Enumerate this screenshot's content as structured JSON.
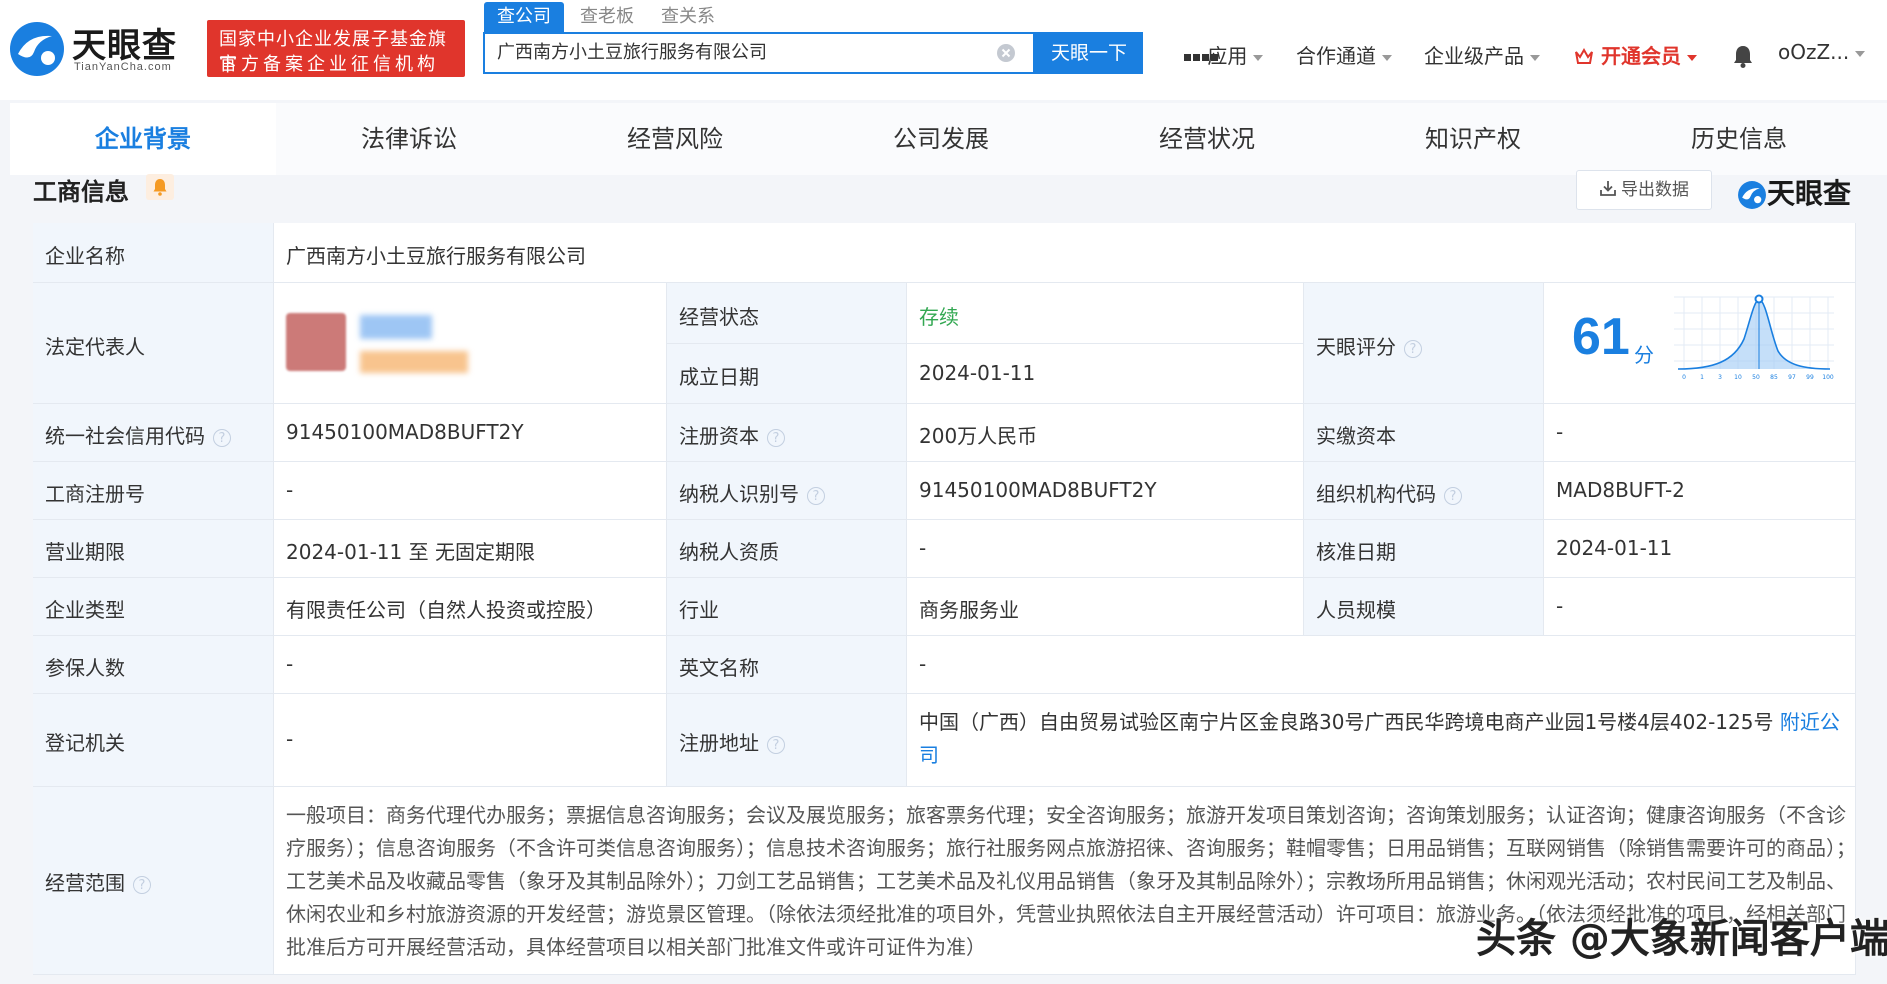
{
  "header": {
    "logo_text": "天眼查",
    "logo_sub": "TianYanCha.com",
    "gov_badge_line1": "国家中小企业发展子基金旗下",
    "gov_badge_line2": "官方备案企业征信机构",
    "search_tabs": [
      "查公司",
      "查老板",
      "查关系"
    ],
    "search_value": "广西南方小土豆旅行服务有限公司",
    "search_button": "天眼一下",
    "nav": {
      "apps": "应用",
      "partner": "合作通道",
      "enterprise": "企业级产品",
      "vip": "开通会员",
      "user": "oOzZ..."
    }
  },
  "tabs": [
    "企业背景",
    "法律诉讼",
    "经营风险",
    "公司发展",
    "经营状况",
    "知识产权",
    "历史信息"
  ],
  "section": {
    "title": "工商信息",
    "export": "导出数据",
    "brand": "天眼查"
  },
  "info": {
    "company_name_label": "企业名称",
    "company_name": "广西南方小土豆旅行服务有限公司",
    "legal_rep_label": "法定代表人",
    "status_label": "经营状态",
    "status": "存续",
    "founded_label": "成立日期",
    "founded": "2024-01-11",
    "score_label": "天眼评分",
    "score": "61",
    "score_unit": "分",
    "credit_code_label": "统一社会信用代码",
    "credit_code": "91450100MAD8BUFT2Y",
    "reg_capital_label": "注册资本",
    "reg_capital": "200万人民币",
    "paid_capital_label": "实缴资本",
    "paid_capital": "-",
    "reg_no_label": "工商注册号",
    "reg_no": "-",
    "taxpayer_id_label": "纳税人识别号",
    "taxpayer_id": "91450100MAD8BUFT2Y",
    "org_code_label": "组织机构代码",
    "org_code": "MAD8BUFT-2",
    "term_label": "营业期限",
    "term": "2024-01-11 至 无固定期限",
    "taxpayer_qual_label": "纳税人资质",
    "taxpayer_qual": "-",
    "approve_date_label": "核准日期",
    "approve_date": "2024-01-11",
    "type_label": "企业类型",
    "type": "有限责任公司（自然人投资或控股）",
    "industry_label": "行业",
    "industry": "商务服务业",
    "staff_label": "人员规模",
    "staff": "-",
    "insured_label": "参保人数",
    "insured": "-",
    "english_label": "英文名称",
    "english": "-",
    "authority_label": "登记机关",
    "authority": "-",
    "address_label": "注册地址",
    "address": "中国（广西）自由贸易试验区南宁片区金良路30号广西民华跨境电商产业园1号楼4层402-125号",
    "nearby": "附近公司",
    "scope_label": "经营范围",
    "scope": "一般项目：商务代理代办服务；票据信息咨询服务；会议及展览服务；旅客票务代理；安全咨询服务；旅游开发项目策划咨询；咨询策划服务；认证咨询；健康咨询服务（不含诊疗服务）；信息咨询服务（不含许可类信息咨询服务）；信息技术咨询服务；旅行社服务网点旅游招徕、咨询服务；鞋帽零售；日用品销售；互联网销售（除销售需要许可的商品）；工艺美术品及收藏品零售（象牙及其制品除外）；刀剑工艺品销售；工艺美术品及礼仪用品销售（象牙及其制品除外）；宗教场所用品销售；休闲观光活动；农村民间工艺及制品、休闲农业和乡村旅游资源的开发经营；游览景区管理。（除依法须经批准的项目外，凭营业执照依法自主开展经营活动）许可项目：旅游业务。（依法须经批准的项目，经相关部门批准后方可开展经营活动，具体经营项目以相关部门批准文件或许可证件为准）"
  },
  "score_chart_ticks": [
    "0",
    "1",
    "3",
    "10",
    "50",
    "85",
    "97",
    "99",
    "100"
  ],
  "watermark": "头条 @大象新闻客户端",
  "colors": {
    "accent": "#1a7fe0",
    "badge_red": "#e0352c",
    "status_green": "#33a852",
    "label_bg": "#f1f6fc"
  }
}
